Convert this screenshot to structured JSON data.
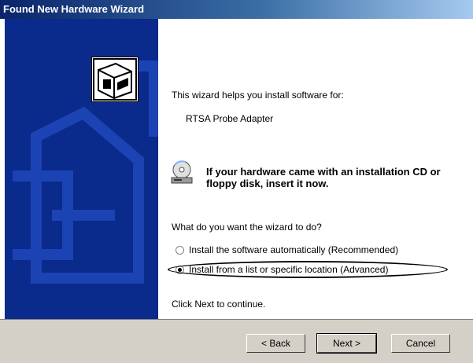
{
  "window": {
    "title": "Found New Hardware Wizard"
  },
  "content": {
    "intro": "This wizard helps you install software for:",
    "device_name": "RTSA Probe Adapter",
    "cd_notice": "If your hardware came with an installation CD or floppy disk, insert it now.",
    "question": "What do you want the wizard to do?",
    "options": [
      {
        "label": "Install the software automatically (Recommended)",
        "selected": false
      },
      {
        "label": "Install from a list or specific location (Advanced)",
        "selected": true
      }
    ],
    "footer": "Click Next to continue."
  },
  "buttons": {
    "back": "< Back",
    "next": "Next >",
    "cancel": "Cancel"
  },
  "colors": {
    "sidebar": "#0a2a8c",
    "button_face": "#d4d0c8"
  },
  "icons": {
    "sidebar": "hardware-icon",
    "cd": "cd-install-icon"
  }
}
